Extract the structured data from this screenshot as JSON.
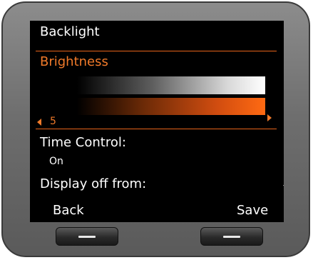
{
  "screen": {
    "title": "Backlight",
    "subtitle": "Brightness",
    "brightness": {
      "value": "5"
    },
    "time_control": {
      "label": "Time Control:",
      "value": "On"
    },
    "display_off": {
      "label": "Display off from:"
    }
  },
  "softkeys": {
    "left": "Back",
    "right": "Save"
  },
  "icons": {
    "left": "arrow-left-icon",
    "right": "arrow-right-icon",
    "down": "arrow-down-icon"
  },
  "colors": {
    "accent": "#f07a2a",
    "screen_bg": "#000000",
    "text": "#ffffff",
    "device": "#7a7a7a"
  }
}
